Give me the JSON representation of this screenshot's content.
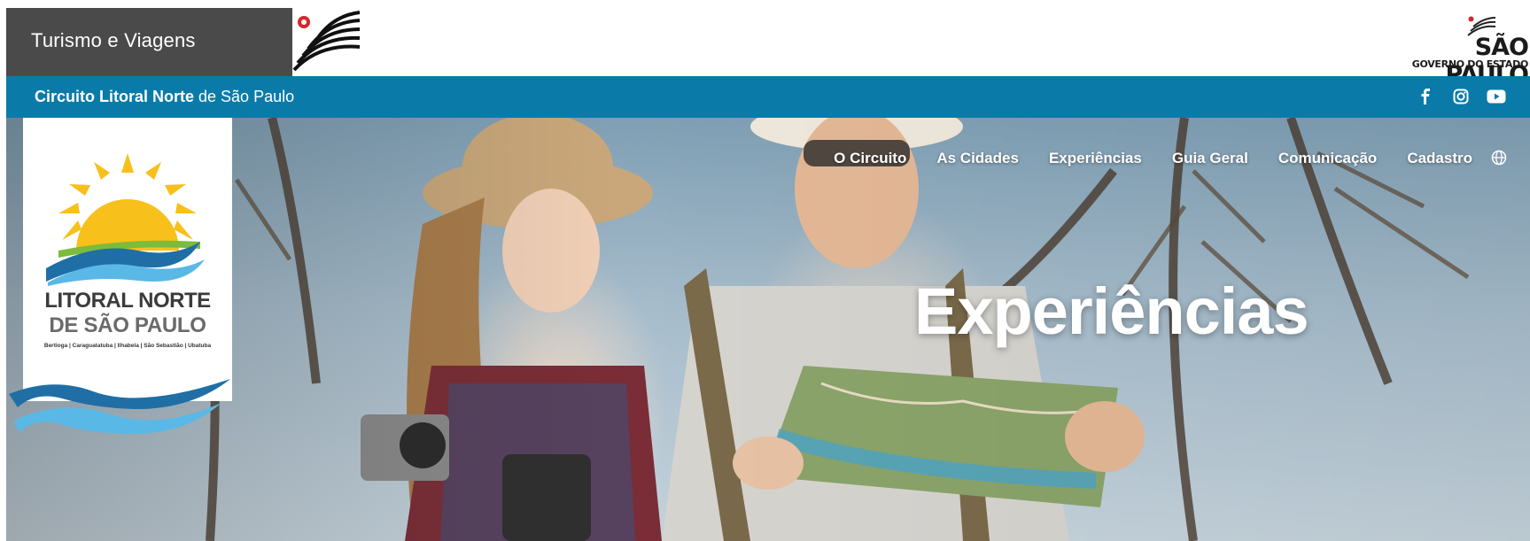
{
  "gov": {
    "label": "Turismo e Viagens",
    "logo_title": "SÃO PAULO",
    "logo_subtitle": "GOVERNO DO ESTADO"
  },
  "circuit": {
    "title_bold": "Circuito Litoral Norte",
    "title_rest": " de São Paulo",
    "social": [
      "facebook-icon",
      "instagram-icon",
      "youtube-icon"
    ]
  },
  "nav": {
    "items": [
      "O Circuito",
      "As Cidades",
      "Experiências",
      "Guia Geral",
      "Comunicação",
      "Cadastro"
    ],
    "language_icon": "globe-icon"
  },
  "hero": {
    "title": "Experiências"
  },
  "logo": {
    "line1": "LITORAL NORTE",
    "line2": "DE SÃO PAULO",
    "cities": "Bertioga | Caraguatatuba | Ilhabela | São Sebastião | Ubatuba"
  },
  "colors": {
    "gov_bar": "#4a4a4a",
    "circuit_bar": "#0a7ba8",
    "sun": "#f8c01a",
    "wave_dark": "#1f6fa6",
    "wave_light": "#5ab8e6",
    "green": "#7dbb3c"
  }
}
